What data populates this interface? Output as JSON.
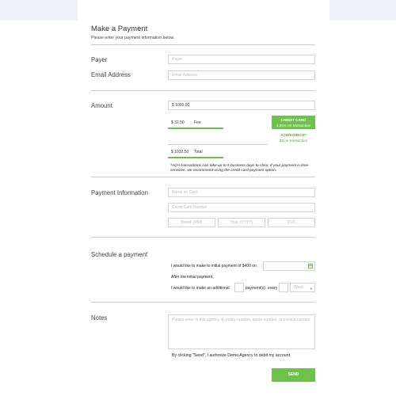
{
  "header": {
    "title": "Make a Payment",
    "subtitle": "Please enter your payment information below."
  },
  "payer": {
    "label": "Payer",
    "placeholder": "Payer"
  },
  "email": {
    "label": "Email Address",
    "placeholder": "Email Address"
  },
  "amount": {
    "label": "Amount",
    "value": "$ 1000.00",
    "fee_value": "$ 32.50",
    "fee_label": "Fee",
    "total_value": "$ 1032.50",
    "total_label": "Total"
  },
  "payment_methods": {
    "credit_card": {
      "title": "CREDIT CARD",
      "detail": "3.25% on transaction",
      "selected": true
    },
    "ach": {
      "title": "ACH/ECHECK*",
      "detail": "$3 on transaction",
      "selected": false
    }
  },
  "ach_note": "*ACH transactions can take up to 5 business days to clear.  If your payment is time-sensitive, we recommend using the credit card payment option.",
  "payment_info": {
    "label": "Payment Information",
    "name_placeholder": "Name on Card",
    "card_placeholder": "Credit Card Number",
    "month_placeholder": "Month (MM)",
    "year_placeholder": "Year (YYYY)",
    "cvc_placeholder": "CVC"
  },
  "schedule": {
    "label": "Schedule a payment",
    "initial_text": "I would like to make to initial payment of $400 on",
    "after_text": "After the initial payment,",
    "additional_text": "I would like to make an additional",
    "payments_text": "payment(s)",
    "every_text": "every",
    "period_option": "Week"
  },
  "notes": {
    "label": "Notes",
    "placeholder": "Please enter in this agency id, policy number, quote number, or invoice number"
  },
  "authorization": "By clicking \"Send\", I authorize Demo Agency to debit my account.",
  "send_label": "SEND",
  "colors": {
    "accent": "#6cc24a",
    "topbar": "#eef2f7"
  }
}
